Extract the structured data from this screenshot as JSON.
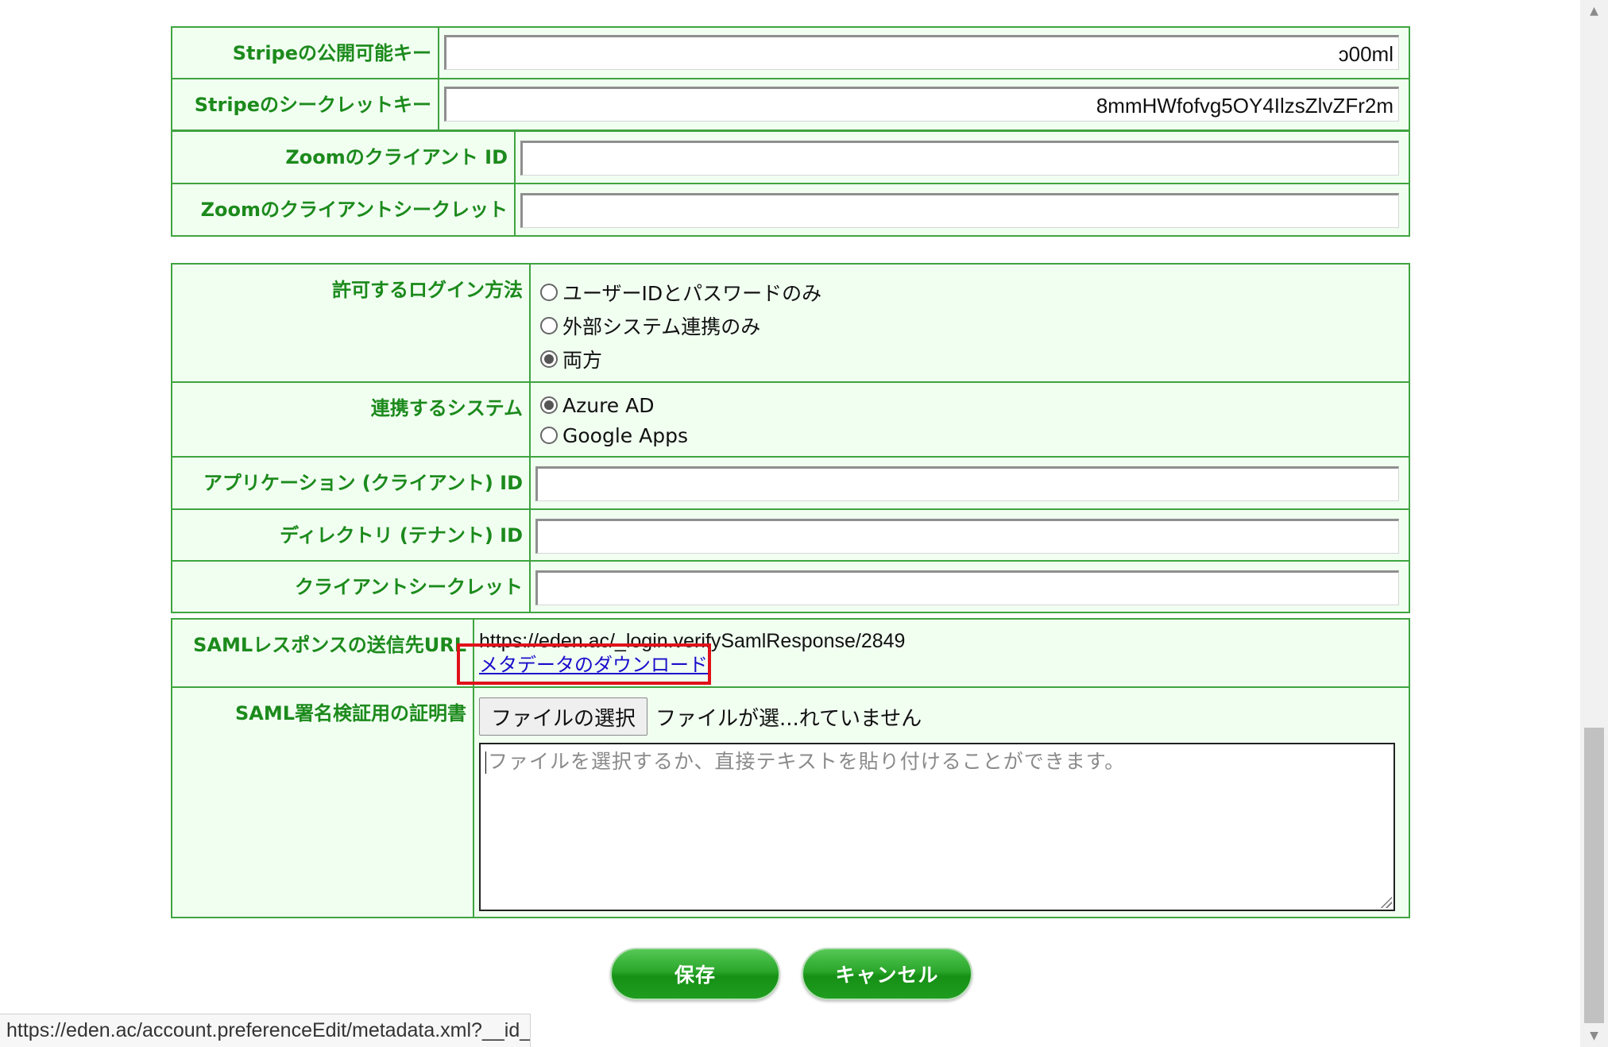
{
  "stripe_table": {
    "rows": [
      {
        "label": "Stripeの公開可能キー",
        "value": "ɔ00ml"
      },
      {
        "label": "Stripeのシークレットキー",
        "value": "8mmHWfofvg5OY4IlzsZlvZFr2m"
      }
    ]
  },
  "zoom_table": {
    "rows": [
      {
        "label": "Zoomのクライアント ID",
        "value": ""
      },
      {
        "label": "Zoomのクライアントシークレット",
        "value": ""
      }
    ]
  },
  "login_table": {
    "login_method": {
      "label": "許可するログイン方法",
      "options": [
        "ユーザーIDとパスワードのみ",
        "外部システム連携のみ",
        "両方"
      ],
      "selected": "両方"
    },
    "system": {
      "label": "連携するシステム",
      "options": [
        "Azure AD",
        "Google Apps"
      ],
      "selected": "Azure AD"
    },
    "app_id": {
      "label": "アプリケーション (クライアント) ID",
      "value": ""
    },
    "tenant_id": {
      "label": "ディレクトリ (テナント) ID",
      "value": ""
    },
    "client_secret": {
      "label": "クライアントシークレット",
      "value": ""
    }
  },
  "saml_table": {
    "response_url": {
      "label": "SAMLレスポンスの送信先URL",
      "url": "https://eden.ac/_login.verifySamlResponse/2849",
      "download_link": "メタデータのダウンロード"
    },
    "certificate": {
      "label": "SAML署名検証用の証明書",
      "file_button": "ファイルの選択",
      "file_status": "ファイルが選...れていません",
      "textarea_placeholder": "ファイルを選択するか、直接テキストを貼り付けることができます。"
    }
  },
  "actions": {
    "save": "保存",
    "cancel": "キャンセル"
  },
  "status_bar": {
    "url": "https://eden.ac/account.preferenceEdit/metadata.xml?__id_..."
  },
  "colors": {
    "accent": "#3fa43f",
    "label": "#1c8a1c",
    "row_bg": "#f1fff1",
    "highlight": "#e0111a",
    "link": "#1a0dcc"
  }
}
